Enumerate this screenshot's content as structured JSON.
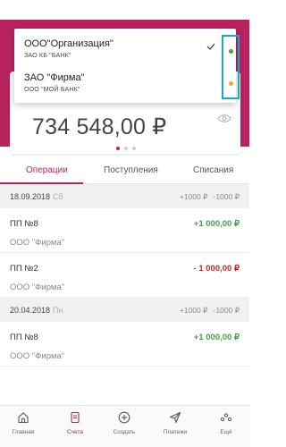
{
  "accounts": [
    {
      "name": "ООО\"Организация\"",
      "bank": "ЗАО КБ \"БАНК\"",
      "selected": true,
      "indicator_color": "#4aa03c"
    },
    {
      "name": "ЗАО \"Фирма\"",
      "bank": "ООО \"МОЙ БАНК\"",
      "selected": false,
      "indicator_color": "#f5a623"
    }
  ],
  "balance": "734 548,00 ₽",
  "tabs": [
    {
      "label": "Операции",
      "active": true
    },
    {
      "label": "Поступления",
      "active": false
    },
    {
      "label": "Списания",
      "active": false
    }
  ],
  "groups": [
    {
      "date": "18.09.2018",
      "weekday": "Сб",
      "income": "+1000 ₽",
      "expense": "-1000 ₽",
      "operations": [
        {
          "title": "ПП №8",
          "party": "ООО \"Фирма\"",
          "amount": "+1 000,00 ₽",
          "type": "plus"
        },
        {
          "title": "ПП №2",
          "party": "ООО \"Фирма\"",
          "amount": "- 1 000,00 ₽",
          "type": "minus"
        }
      ]
    },
    {
      "date": "20.04.2018",
      "weekday": "Пн",
      "income": "+1000 ₽",
      "expense": "-1000 ₽",
      "operations": [
        {
          "title": "ПП №8",
          "party": "ООО \"Фирма\"",
          "amount": "+1 000,00 ₽",
          "type": "plus"
        }
      ]
    }
  ],
  "nav": [
    {
      "label": "Главная",
      "icon": "home-icon",
      "active": false
    },
    {
      "label": "Счета",
      "icon": "document-icon",
      "active": true
    },
    {
      "label": "Создать",
      "icon": "plus-circle-icon",
      "active": false
    },
    {
      "label": "Платежи",
      "icon": "send-icon",
      "active": false
    },
    {
      "label": "Ещё",
      "icon": "more-icon",
      "active": false
    }
  ],
  "colors": {
    "brand": "#b8235e",
    "income": "#43a047",
    "expense": "#c62828",
    "highlight": "#1aa8c9"
  }
}
